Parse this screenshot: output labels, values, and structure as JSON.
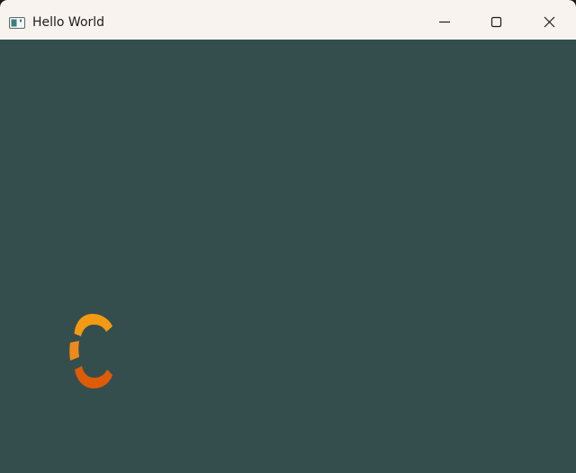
{
  "window": {
    "title": "Hello World",
    "background_color": "#344e4e",
    "titlebar_color": "#f8f3ef"
  },
  "titlebar": {
    "app_icon": "window-app-icon",
    "minimize_icon": "minimize-icon",
    "maximize_icon": "maximize-icon",
    "close_icon": "close-icon"
  },
  "canvas": {
    "loading_spinner": {
      "icon": "loading-spinner-icon",
      "colors": {
        "top_arc": "#f49a12",
        "left_arc": "#ee8a1a",
        "bottom_arc": "#de5b08"
      }
    }
  }
}
